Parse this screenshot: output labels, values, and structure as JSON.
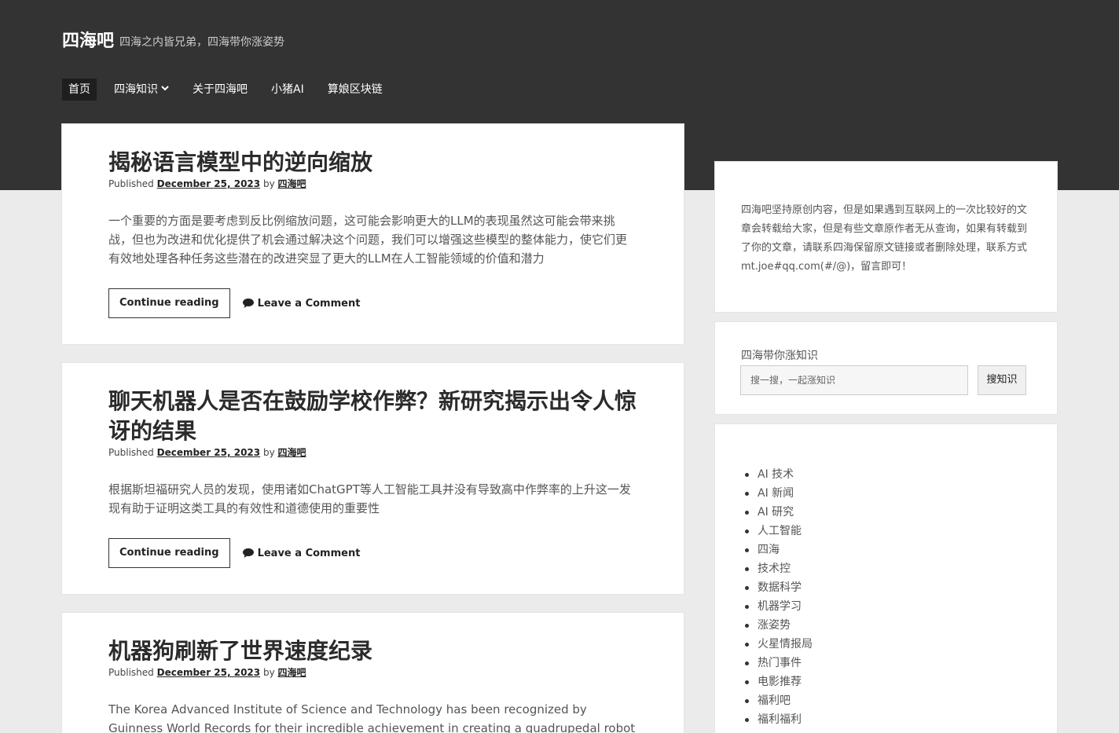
{
  "site": {
    "title": "四海吧",
    "tagline": "四海之内皆兄弟，四海带你涨姿势"
  },
  "nav": {
    "items": [
      {
        "label": "首页",
        "active": true
      },
      {
        "label": "四海知识",
        "has_dropdown": true
      },
      {
        "label": "关于四海吧"
      },
      {
        "label": "小猪AI"
      },
      {
        "label": "算娘区块链"
      }
    ]
  },
  "posts": [
    {
      "title": "揭秘语言模型中的逆向缩放",
      "published_prefix": "Published",
      "date": "December 25, 2023",
      "by": "by",
      "author": "四海吧",
      "excerpt": "一个重要的方面是要考虑到反比例缩放问题，这可能会影响更大的LLM的表现虽然这可能会带来挑战，但也为改进和优化提供了机会通过解决这个问题，我们可以增强这些模型的整体能力，使它们更有效地处理各种任务这些潜在的改进突显了更大的LLM在人工智能领域的价值和潜力",
      "continue_label": "Continue reading",
      "comment_label": "Leave a Comment"
    },
    {
      "title": "聊天机器人是否在鼓励学校作弊？新研究揭示出令人惊讶的结果",
      "published_prefix": "Published",
      "date": "December 25, 2023",
      "by": "by",
      "author": "四海吧",
      "excerpt": "根据斯坦福研究人员的发现，使用诸如ChatGPT等人工智能工具并没有导致高中作弊率的上升这一发现有助于证明这类工具的有效性和道德使用的重要性",
      "continue_label": "Continue reading",
      "comment_label": "Leave a Comment"
    },
    {
      "title": "机器狗刷新了世界速度纪录",
      "published_prefix": "Published",
      "date": "December 25, 2023",
      "by": "by",
      "author": "四海吧",
      "excerpt": "The Korea Advanced Institute of Science and Technology has been recognized by Guinness World Records for their incredible achievement in creating a quadrupedal robot with dog-like"
    }
  ],
  "sidebar": {
    "notice": "四海吧坚持原创内容，但是如果遇到互联网上的一次比较好的文章会转载给大家，但是有些文章原作者无从查询，如果有转载到了你的文章，请联系四海保留原文链接或者删除处理，联系方式mt.joe#qq.com(#/@)，留言即可！",
    "search": {
      "label": "四海带你涨知识",
      "placeholder": "搜一搜，一起涨知识",
      "button": "搜知识"
    },
    "categories": [
      "AI 技术",
      "AI 新闻",
      "AI 研究",
      "人工智能",
      "四海",
      "技术控",
      "数据科学",
      "机器学习",
      "涨姿势",
      "火星情报局",
      "热门事件",
      "电影推荐",
      "福利吧",
      "福利福利"
    ]
  }
}
